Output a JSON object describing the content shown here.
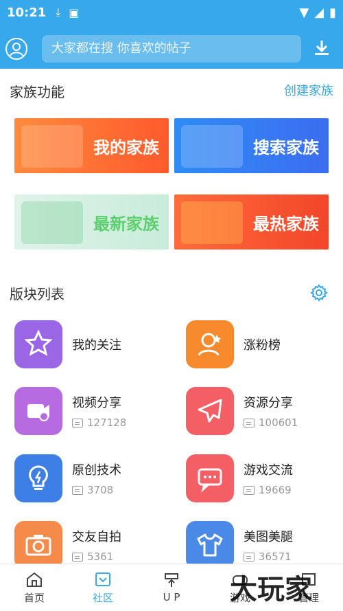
{
  "status": {
    "time": "10:21"
  },
  "search": {
    "placeholder": "大家都在搜  你喜欢的帖子"
  },
  "family": {
    "title": "家族功能",
    "create_label": "创建家族",
    "banners": [
      "我的家族",
      "搜索家族",
      "最新家族",
      "最热家族"
    ]
  },
  "boards": {
    "title": "版块列表",
    "items": [
      {
        "name": "我的关注",
        "count": "",
        "icon": "star-icon",
        "color": "#9a66e5"
      },
      {
        "name": "涨粉榜",
        "count": "",
        "icon": "profile-star-icon",
        "color": "#f68a2d"
      },
      {
        "name": "视频分享",
        "count": "127128",
        "icon": "video-share-icon",
        "color": "#b66be0"
      },
      {
        "name": "资源分享",
        "count": "100601",
        "icon": "paper-plane-icon",
        "color": "#f45f66"
      },
      {
        "name": "原创技术",
        "count": "3708",
        "icon": "bulb-icon",
        "color": "#3e7fe6"
      },
      {
        "name": "游戏交流",
        "count": "19669",
        "icon": "chat-icon",
        "color": "#f45f66"
      },
      {
        "name": "交友自拍",
        "count": "5361",
        "icon": "camera-icon",
        "color": "#f48b4a"
      },
      {
        "name": "美图美腿",
        "count": "36571",
        "icon": "shirt-icon",
        "color": "#4a8ae6"
      }
    ]
  },
  "nav": {
    "items": [
      {
        "label": "首页",
        "icon": "home-icon"
      },
      {
        "label": "社区",
        "icon": "community-icon"
      },
      {
        "label": "U P",
        "icon": "upload-icon"
      },
      {
        "label": "游戏",
        "icon": "game-icon"
      },
      {
        "label": "管理",
        "icon": "manage-icon"
      }
    ],
    "active": "社区"
  },
  "watermark": "大玩家"
}
